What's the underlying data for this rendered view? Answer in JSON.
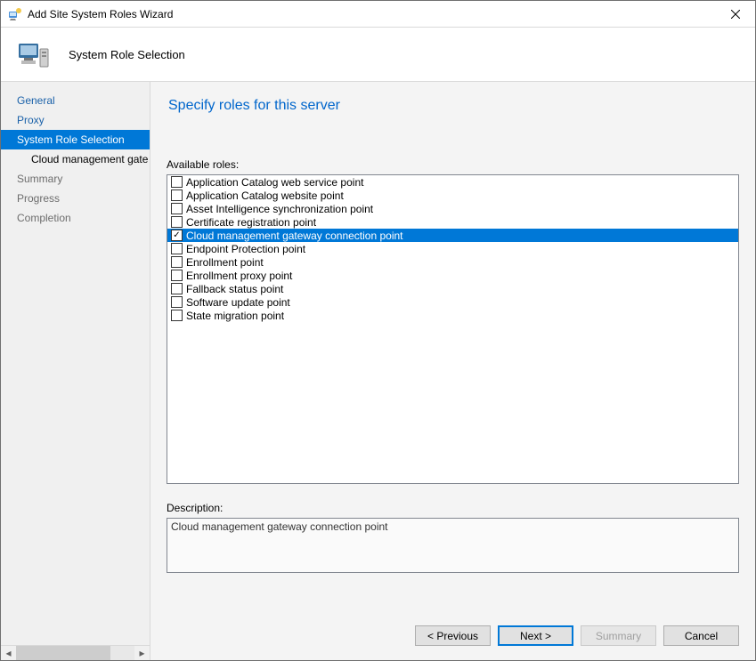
{
  "titlebar": {
    "title": "Add Site System Roles Wizard"
  },
  "header": {
    "title": "System Role Selection"
  },
  "sidebar": {
    "items": [
      {
        "label": "General",
        "type": "link"
      },
      {
        "label": "Proxy",
        "type": "link"
      },
      {
        "label": "System Role Selection",
        "type": "active"
      },
      {
        "label": "Cloud management gate",
        "type": "sub"
      },
      {
        "label": "Summary",
        "type": "muted"
      },
      {
        "label": "Progress",
        "type": "muted"
      },
      {
        "label": "Completion",
        "type": "muted"
      }
    ]
  },
  "content": {
    "heading": "Specify roles for this server",
    "available_label": "Available roles:",
    "roles": [
      {
        "label": "Application Catalog web service point",
        "checked": false,
        "selected": false
      },
      {
        "label": "Application Catalog website point",
        "checked": false,
        "selected": false
      },
      {
        "label": "Asset Intelligence synchronization point",
        "checked": false,
        "selected": false
      },
      {
        "label": "Certificate registration point",
        "checked": false,
        "selected": false
      },
      {
        "label": "Cloud management gateway connection point",
        "checked": true,
        "selected": true
      },
      {
        "label": "Endpoint Protection point",
        "checked": false,
        "selected": false
      },
      {
        "label": "Enrollment point",
        "checked": false,
        "selected": false
      },
      {
        "label": "Enrollment proxy point",
        "checked": false,
        "selected": false
      },
      {
        "label": "Fallback status point",
        "checked": false,
        "selected": false
      },
      {
        "label": "Software update point",
        "checked": false,
        "selected": false
      },
      {
        "label": "State migration point",
        "checked": false,
        "selected": false
      }
    ],
    "description_label": "Description:",
    "description": "Cloud management gateway connection point"
  },
  "footer": {
    "previous": "<  Previous",
    "next": "Next  >",
    "summary": "Summary",
    "cancel": "Cancel"
  }
}
